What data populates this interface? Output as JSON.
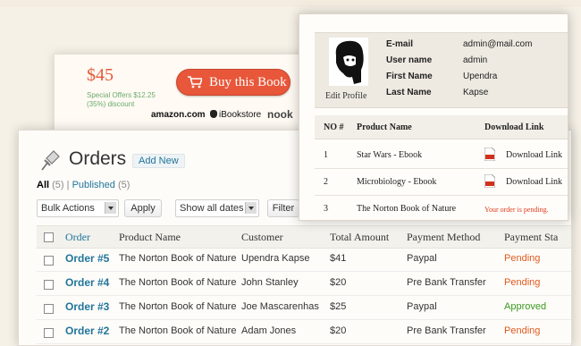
{
  "buy_card": {
    "price": "$45",
    "special_offer": "Special Offers $12.25 (35%) discount",
    "button_label": "Buy this Book",
    "stores": {
      "amazon": "amazon.com",
      "ibookstore": "iBookstore",
      "nook": "nook"
    }
  },
  "orders": {
    "title": "Orders",
    "add_new": "Add New",
    "filters": {
      "all_label": "All",
      "all_count": "(5)",
      "published_label": "Published",
      "published_count": "(5)"
    },
    "bulk_actions": "Bulk Actions",
    "apply": "Apply",
    "dates": "Show all dates",
    "filter": "Filter",
    "columns": [
      "Order",
      "Product Name",
      "Customer",
      "Total Amount",
      "Payment Method",
      "Payment Sta"
    ],
    "rows": [
      {
        "order": "Order #5",
        "product": "The Norton Book of Nature",
        "customer": "Upendra Kapse",
        "total": "$41",
        "method": "Paypal",
        "status": "Pending"
      },
      {
        "order": "Order #4",
        "product": "The Norton Book of Nature",
        "customer": "John Stanley",
        "total": "$20",
        "method": "Pre Bank Transfer",
        "status": "Pending"
      },
      {
        "order": "Order #3",
        "product": "The Norton Book of Nature",
        "customer": "Joe Mascarenhas",
        "total": "$25",
        "method": "Paypal",
        "status": "Approved"
      },
      {
        "order": "Order #2",
        "product": "The Norton Book of Nature",
        "customer": "Adam Jones",
        "total": "$20",
        "method": "Pre Bank Transfer",
        "status": "Pending"
      }
    ]
  },
  "profile": {
    "edit_profile": "Edit Profile",
    "email_label": "E-mail",
    "email": "admin@mail.com",
    "username_label": "User name",
    "username": "admin",
    "firstname_label": "First Name",
    "firstname": "Upendra",
    "lastname_label": "Last Name",
    "lastname": "Kapse",
    "columns": [
      "NO #",
      "Product Name",
      "Download Link"
    ],
    "downloads": [
      {
        "no": "1",
        "product": "Star Wars - Ebook",
        "link": "Download Link"
      },
      {
        "no": "2",
        "product": "Microbiology - Ebook",
        "link": "Download Link"
      },
      {
        "no": "3",
        "product": "The Norton Book of Nature",
        "pending": "Your order is pending."
      }
    ]
  },
  "colors": {
    "accent": "#e8573a",
    "link": "#21759b",
    "pending": "#e05a1f",
    "approved": "#3c9a1f"
  }
}
